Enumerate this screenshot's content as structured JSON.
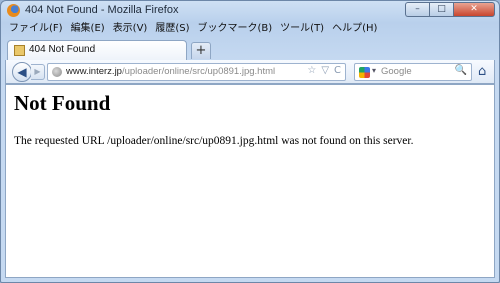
{
  "window": {
    "title": "404 Not Found - Mozilla Firefox",
    "controls": {
      "minimize": "–",
      "maximize": "□",
      "close": "✕"
    }
  },
  "menu": [
    "ファイル(F)",
    "編集(E)",
    "表示(V)",
    "履歴(S)",
    "ブックマーク(B)",
    "ツール(T)",
    "ヘルプ(H)"
  ],
  "tabs": [
    {
      "label": "404 Not Found",
      "active": true
    }
  ],
  "new_tab_label": "+",
  "nav": {
    "back": "◀",
    "forward": "▶",
    "url_host": "www.interz.jp",
    "url_path": "/uploader/online/src/up0891.jpg.html",
    "bookmark_star": "☆",
    "dropdown": "▽",
    "reload": "C",
    "search_placeholder": "Google",
    "search_engine_arrow": "▾",
    "search_button": "🔍",
    "home": "⌂"
  },
  "page": {
    "heading": "Not Found",
    "message": "The requested URL /uploader/online/src/up0891.jpg.html was not found on this server."
  },
  "colors": {
    "frame": "#c5d9f1",
    "close_button": "#c8452e",
    "accent": "#2c4f85"
  }
}
